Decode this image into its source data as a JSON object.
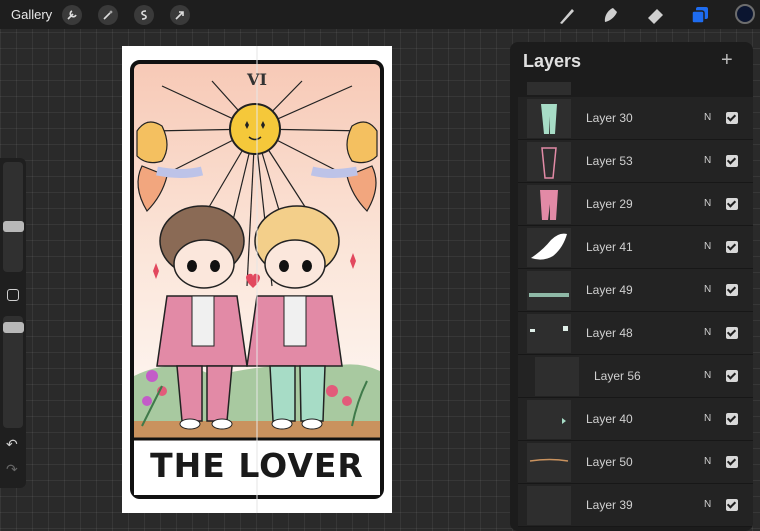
{
  "topbar": {
    "gallery_label": "Gallery",
    "actions": [
      "wrench-icon",
      "magic-wand-icon",
      "selection-icon",
      "transform-arrow-icon"
    ],
    "tools": [
      "brush-icon",
      "smudge-icon",
      "eraser-icon",
      "layers-icon"
    ],
    "color_swatch": "#0b1530",
    "active_tool_color": "#1e6cf0"
  },
  "sidebar": {
    "undo_glyph": "↶",
    "redo_glyph": "↷"
  },
  "canvas": {
    "numeral": "VI",
    "title": "THE LOVER"
  },
  "layers": {
    "title": "Layers",
    "add_glyph": "+",
    "items": [
      {
        "name": "Layer 30",
        "mode": "N",
        "visible": true
      },
      {
        "name": "Layer 53",
        "mode": "N",
        "visible": true
      },
      {
        "name": "Layer 29",
        "mode": "N",
        "visible": true
      },
      {
        "name": "Layer 41",
        "mode": "N",
        "visible": true
      },
      {
        "name": "Layer 49",
        "mode": "N",
        "visible": true
      },
      {
        "name": "Layer 48",
        "mode": "N",
        "visible": true
      },
      {
        "name": "Layer 56",
        "mode": "N",
        "visible": true
      },
      {
        "name": "Layer 40",
        "mode": "N",
        "visible": true
      },
      {
        "name": "Layer 50",
        "mode": "N",
        "visible": true
      },
      {
        "name": "Layer 39",
        "mode": "N",
        "visible": true
      }
    ]
  }
}
